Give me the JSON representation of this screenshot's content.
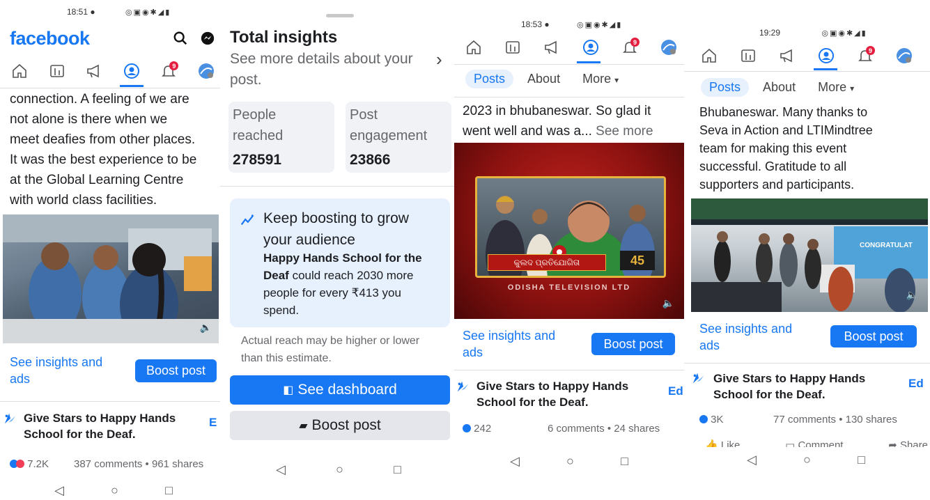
{
  "panel1": {
    "time": "18:51",
    "logo": "facebook",
    "icons": [
      "search-icon",
      "messenger-icon",
      "home-icon",
      "video-icon",
      "megaphone-icon",
      "profile-icon",
      "bell-icon",
      "avatar"
    ],
    "notif_badge": "9",
    "post_text_lines": [
      "connection. A feeling of we are",
      "not alone is there when we",
      "meet deafies from other places.",
      "It was the best experience to be",
      "at the Global Learning Centre",
      "with world class facilities."
    ],
    "insights_link": [
      "See insights and",
      "ads"
    ],
    "boost_label": "Boost post",
    "stars_lines": [
      "Give Stars to Happy Hands",
      "School for the Deaf."
    ],
    "edit_cut": "E",
    "reactions_count": "7.2K",
    "comments_shares": "387 comments • 961 shares"
  },
  "panel2": {
    "title": "Total insights",
    "subtitle_lines": [
      "See more details about your",
      "post."
    ],
    "people_reached_label": [
      "People",
      "reached"
    ],
    "people_reached": "278591",
    "engagement_label": [
      "Post",
      "engagement"
    ],
    "engagement": "23866",
    "boost_heading_lines": [
      "Keep boosting to grow",
      "your audience"
    ],
    "boost_body_bold": "Happy Hands School for the Deaf",
    "boost_body_lines": [
      "could reach 2030 more",
      "people for every ₹413 you",
      "spend."
    ],
    "boost_body_bold_lines": [
      "Happy Hands School for the",
      "Deaf"
    ],
    "estimate_lines": [
      "Actual reach may be higher or lower",
      "than this estimate."
    ],
    "dashboard_label": "See dashboard",
    "boost_label": "Boost post"
  },
  "panel3": {
    "time": "18:53",
    "notif_badge": "9",
    "tabs": [
      "Posts",
      "About",
      "More"
    ],
    "post_text_lines": [
      "2023 in bhubaneswar. So glad it",
      "went well and was a..."
    ],
    "see_more": "See more",
    "tv_caption": "ODISHA TELEVISION LTD",
    "tv_channel_text": "କୁଲଦ ପ୍ରତିଯୋଗିତା",
    "insights_link": [
      "See insights and",
      "ads"
    ],
    "boost_label": "Boost post",
    "stars_lines": [
      "Give Stars to Happy Hands",
      "School for the Deaf."
    ],
    "edit_cut": "Ed",
    "reactions_count": "242",
    "comments_shares": "6 comments • 24 shares"
  },
  "panel4": {
    "time": "19:29",
    "notif_badge": "9",
    "tabs": [
      "Posts",
      "About",
      "More"
    ],
    "post_text_lines": [
      "Bhubaneswar. Many thanks to",
      "Seva in Action and LTIMindtree",
      "team for making this event",
      "successful. Gratitude to all",
      "supporters and participants."
    ],
    "banner_text": "CONGRATULAT",
    "insights_link": [
      "See insights and",
      "ads"
    ],
    "boost_label": "Boost post",
    "stars_lines": [
      "Give Stars to Happy Hands",
      "School for the Deaf."
    ],
    "edit_cut": "Ed",
    "reactions_count": "3K",
    "comments_shares": "77 comments • 130 shares",
    "actions": [
      "Like",
      "Comment",
      "Share"
    ]
  },
  "colors": {
    "fb_blue": "#1877f2",
    "text": "#1c1e21",
    "muted": "#65676b",
    "card": "#f0f2f5"
  }
}
